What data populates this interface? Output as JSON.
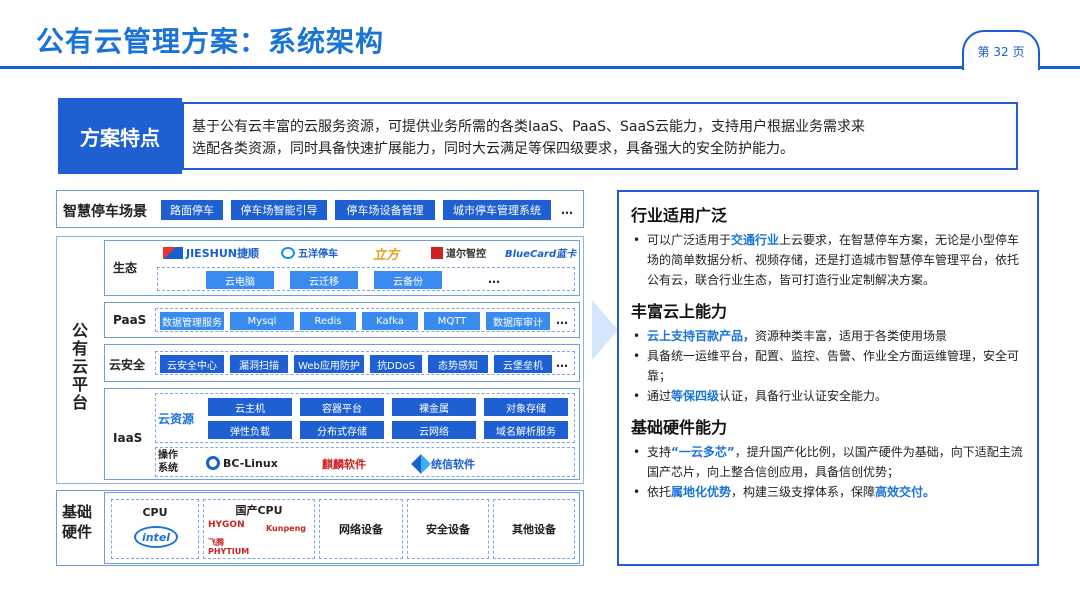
{
  "header": {
    "title": "公有云管理方案：系统架构",
    "page": "第 32 页"
  },
  "feature": {
    "label": "方案特点",
    "text_line1": "基于公有云丰富的云服务资源，可提供业务所需的各类IaaS、PaaS、SaaS云能力，支持用户根据业务需求来",
    "text_line2": "选配各类资源，同时具备快速扩展能力，同时大云满足等保四级要求，具备强大的安全防护能力。"
  },
  "diagram": {
    "scene": {
      "label": "智慧停车场景",
      "items": [
        "路面停车",
        "停车场智能引导",
        "停车场设备管理",
        "城市停车管理系统"
      ],
      "ellipsis": "…"
    },
    "platform_label": "公有云平台",
    "ecosystem": {
      "label": "生态",
      "logos": [
        "JIESHUN捷顺",
        "五洋停车",
        "立方",
        "道尔智控",
        "BlueCard蓝卡"
      ],
      "items": [
        "云电脑",
        "云迁移",
        "云备份"
      ],
      "ellipsis": "…"
    },
    "paas": {
      "label": "PaaS",
      "items": [
        "数据管理服务",
        "Mysql",
        "Redis",
        "Kafka",
        "MQTT",
        "数据库审计"
      ],
      "ellipsis": "…"
    },
    "security": {
      "label": "云安全",
      "items": [
        "云安全中心",
        "漏洞扫描",
        "Web应用防护",
        "抗DDoS",
        "态势感知",
        "云堡垒机"
      ],
      "ellipsis": "…"
    },
    "iaas": {
      "label": "IaaS",
      "resource_label": "云资源",
      "items": [
        "云主机",
        "容器平台",
        "裸金属",
        "对象存储",
        "弹性负载",
        "分布式存储",
        "云网络",
        "域名解析服务"
      ],
      "os_label_1": "操作",
      "os_label_2": "系统",
      "os": [
        "BC-Linux",
        "麒麟软件",
        "统信软件"
      ]
    },
    "hardware": {
      "label_1": "基础",
      "label_2": "硬件",
      "cpu_label": "CPU",
      "cpu_logo": "intel",
      "domestic_cpu_label": "国产CPU",
      "domestic_logos": [
        "HYGON",
        "Kunpeng",
        "飞腾 PHYTIUM"
      ],
      "items": [
        "网络设备",
        "安全设备",
        "其他设备"
      ]
    }
  },
  "right": {
    "s1": {
      "title": "行业适用广泛",
      "b1_pre": "可以广泛适用于",
      "b1_hl": "交通行业",
      "b1_post": "上云要求，在智慧停车方案，无论是小型停车场的简单数据分析、视频存储，还是打造城市智慧停车管理平台，依托公有云，联合行业生态，皆可打造行业定制解决方案。"
    },
    "s2": {
      "title": "丰富云上能力",
      "b1_hl": "云上支持百款产品，",
      "b1_post": "资源种类丰富，适用于各类使用场景",
      "b2": "具备统一运维平台，配置、监控、告警、作业全方面运维管理，安全可靠；",
      "b3_pre": "通过",
      "b3_hl": "等保四级",
      "b3_post": "认证，具备行业认证安全能力。"
    },
    "s3": {
      "title": "基础硬件能力",
      "b1_pre": "支持",
      "b1_hl": "“一云多芯”",
      "b1_post": "，提升国产化比例，以国产硬件为基础，向下适配主流国产芯片，向上整合信创应用，具备信创优势；",
      "b2_pre": "依托",
      "b2_hl": "属地化优势",
      "b2_mid": "，构建三级支撑体系，保障",
      "b2_hl2": "高效交付。"
    }
  },
  "colors": {
    "primary": "#1e5fd2",
    "accent": "#1a73d8"
  }
}
